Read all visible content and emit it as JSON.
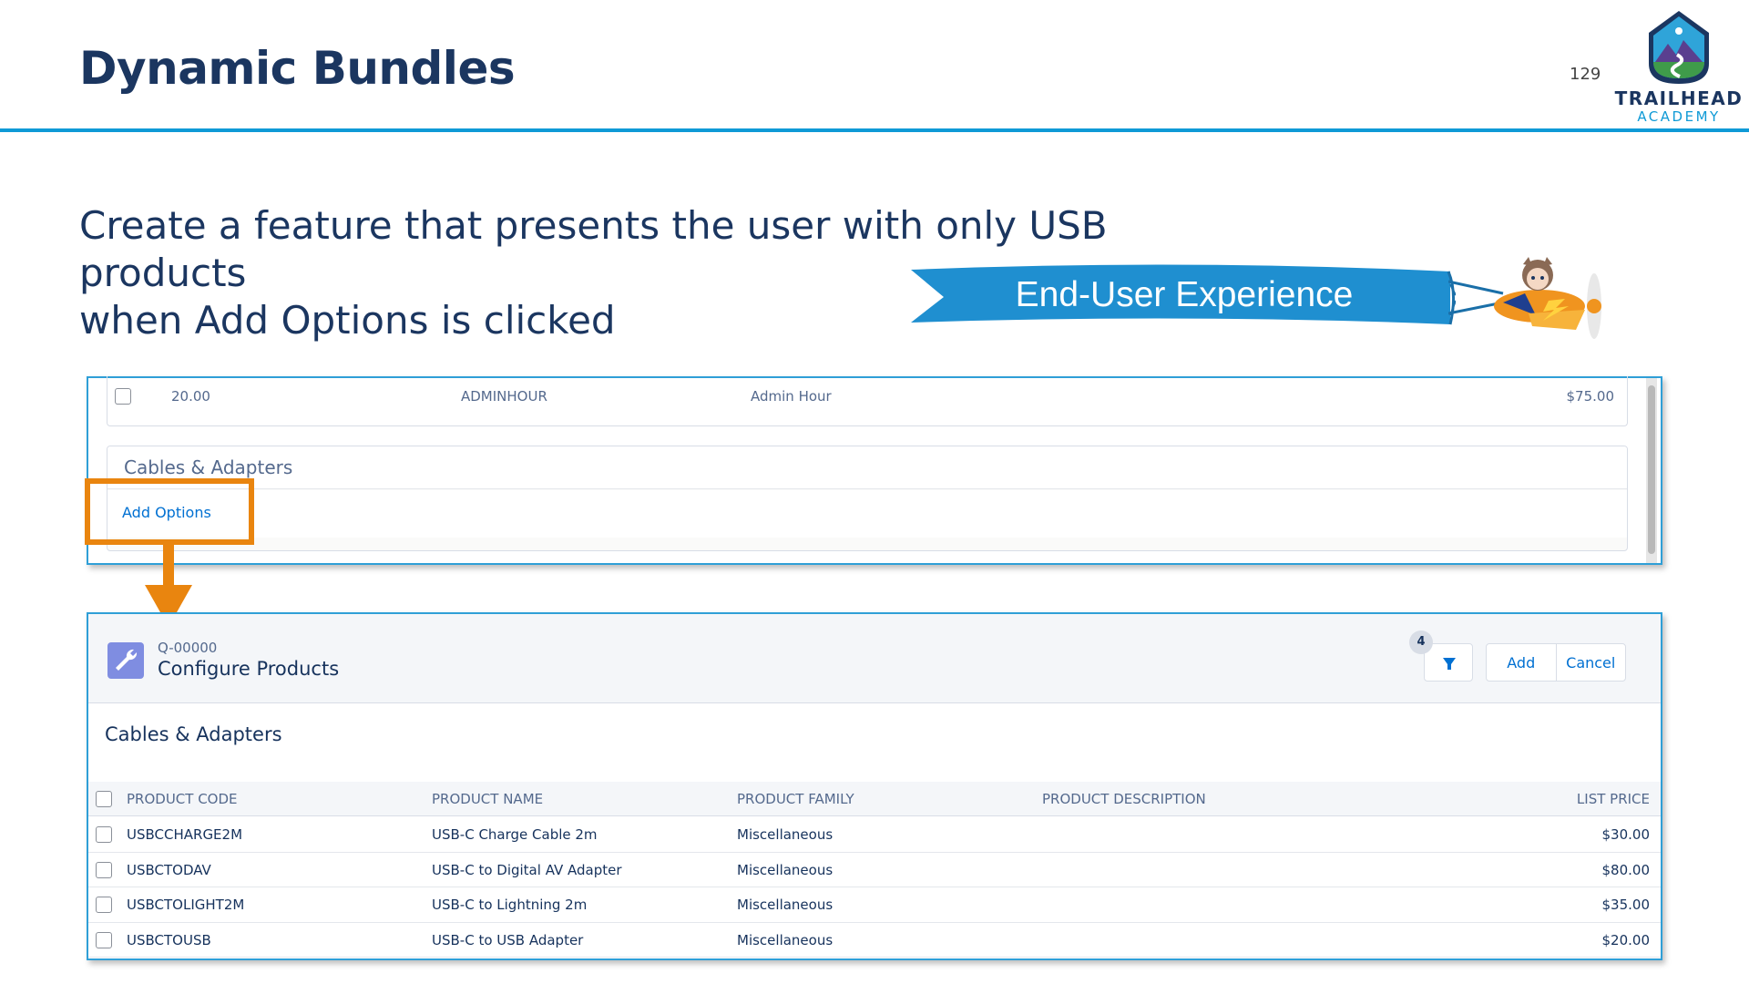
{
  "slide": {
    "title": "Dynamic Bundles",
    "page_number": "129",
    "logo_line1": "TRAILHEAD",
    "logo_line2": "ACADEMY",
    "subtitle_line1": "Create a feature that presents the user with only USB products",
    "subtitle_line2": "when Add Options is clicked",
    "banner_text": "End-User Experience",
    "accent_color": "#0f9ad6",
    "highlight_color": "#e9850f"
  },
  "bundle_panel": {
    "row": {
      "quantity": "20.00",
      "code": "ADMINHOUR",
      "name": "Admin Hour",
      "price": "$75.00"
    },
    "group_title": "Cables & Adapters",
    "add_options_label": "Add Options"
  },
  "configure_panel": {
    "quote_number": "Q-00000",
    "title": "Configure Products",
    "filter_count": "4",
    "add_label": "Add",
    "cancel_label": "Cancel",
    "section_title": "Cables & Adapters",
    "columns": [
      "PRODUCT CODE",
      "PRODUCT NAME",
      "PRODUCT FAMILY",
      "PRODUCT DESCRIPTION",
      "LIST PRICE"
    ],
    "rows": [
      {
        "code": "USBCCHARGE2M",
        "name": "USB-C Charge Cable 2m",
        "family": "Miscellaneous",
        "description": "",
        "price": "$30.00"
      },
      {
        "code": "USBCTODAV",
        "name": "USB-C to Digital AV Adapter",
        "family": "Miscellaneous",
        "description": "",
        "price": "$80.00"
      },
      {
        "code": "USBCTOLIGHT2M",
        "name": "USB-C to Lightning 2m",
        "family": "Miscellaneous",
        "description": "",
        "price": "$35.00"
      },
      {
        "code": "USBCTOUSB",
        "name": "USB-C to USB Adapter",
        "family": "Miscellaneous",
        "description": "",
        "price": "$20.00"
      }
    ]
  }
}
